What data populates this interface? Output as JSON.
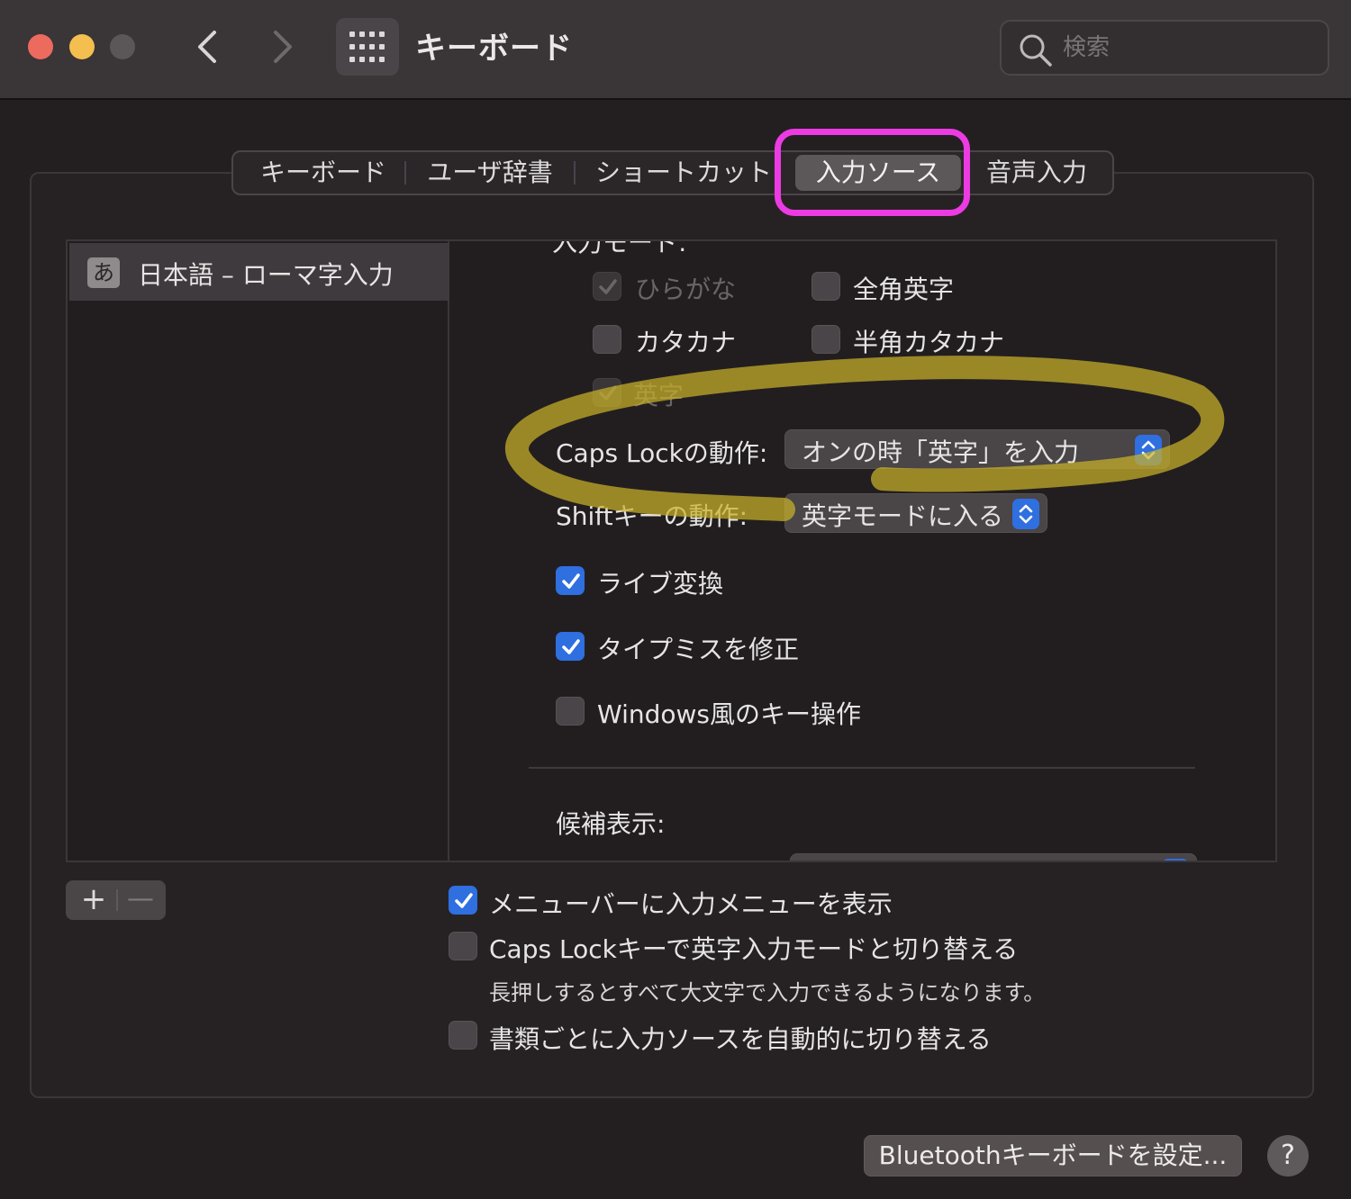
{
  "window": {
    "title": "キーボード",
    "search_placeholder": "検索"
  },
  "tabs": [
    {
      "label": "キーボード"
    },
    {
      "label": "ユーザ辞書"
    },
    {
      "label": "ショートカット"
    },
    {
      "label": "入力ソース",
      "selected": true
    },
    {
      "label": "音声入力"
    }
  ],
  "input_sources": [
    {
      "badge": "あ",
      "label": "日本語 – ローマ字入力",
      "selected": true
    }
  ],
  "settings": {
    "modes": [
      {
        "label": "ひらがな",
        "checked": true,
        "enabled": false
      },
      {
        "label": "全角英字",
        "checked": false,
        "enabled": true
      },
      {
        "label": "カタカナ",
        "checked": false,
        "enabled": true
      },
      {
        "label": "半角カタカナ",
        "checked": false,
        "enabled": true
      },
      {
        "label": "英字",
        "checked": true,
        "enabled": false
      }
    ],
    "caps_lock_label": "Caps Lockの動作:",
    "caps_lock_value": "オンの時「英字」を入力",
    "shift_label": "Shiftキーの動作:",
    "shift_value": "英字モードに入る",
    "live_conversion": {
      "label": "ライブ変換",
      "checked": true
    },
    "typo_fix": {
      "label": "タイプミスを修正",
      "checked": true
    },
    "windows_keys": {
      "label": "Windows風のキー操作",
      "checked": false
    },
    "candidate_label": "候補表示:"
  },
  "list_controls": {
    "add": "+",
    "remove": "—"
  },
  "options": {
    "show_menu": {
      "label": "メニューバーに入力メニューを表示",
      "checked": true
    },
    "caps_lock_switch": {
      "label": "Caps Lockキーで英字入力モードと切り替える",
      "checked": false
    },
    "caps_lock_note": "長押しするとすべて大文字で入力できるようになります。",
    "auto_switch": {
      "label": "書類ごとに入力ソースを自動的に切り替える",
      "checked": false
    }
  },
  "footer": {
    "bluetooth_button": "Bluetoothキーボードを設定...",
    "help_button": "?"
  },
  "colors": {
    "accent": "#2f6fe0",
    "tab_highlight": "#ec3be3",
    "annotation": "#c9b12a"
  }
}
